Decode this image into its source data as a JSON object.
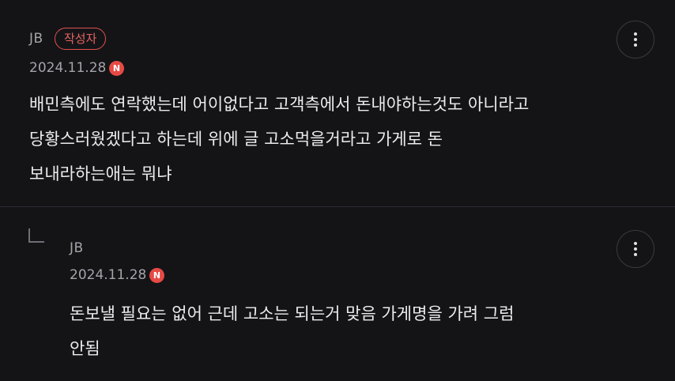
{
  "comments": [
    {
      "author": "JB",
      "author_badge": "작성자",
      "date": "2024.11.28",
      "new_badge": "N",
      "lines": [
        "배민측에도 연락했는데 어이없다고 고객측에서 돈내야하는것도 아니라고",
        "당황스러웠겠다고 하는데 위에 글 고소먹을거라고 가게로 돈",
        "보내라하는애는 뭐냐"
      ],
      "more_icon": "more-vertical-icon"
    },
    {
      "author": "JB",
      "date": "2024.11.28",
      "new_badge": "N",
      "reply_icon": "reply-arrow-icon",
      "lines": [
        "돈보낼 필요는 없어 근데 고소는 되는거 맞음 가게명을 가려 그럼",
        "안됨"
      ],
      "more_icon": "more-vertical-icon"
    }
  ],
  "colors": {
    "background": "#141417",
    "accent_red": "#e64a45",
    "meta_text": "#a3a3aa",
    "body_text": "#ececef"
  }
}
